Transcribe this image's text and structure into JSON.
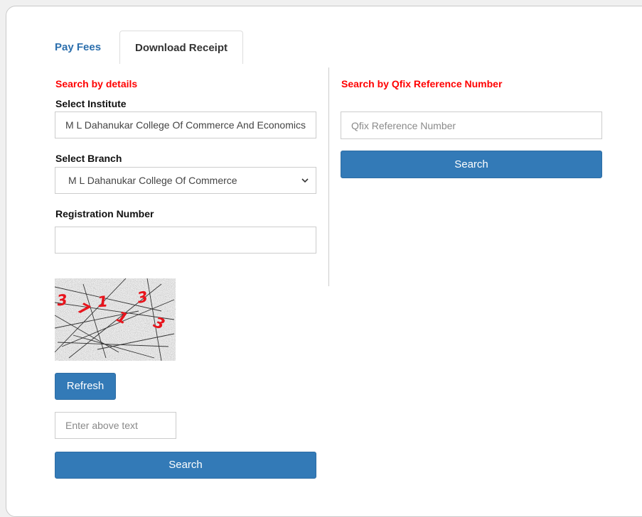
{
  "tabs": {
    "pay_fees": "Pay Fees",
    "download_receipt": "Download Receipt"
  },
  "details": {
    "title": "Search by details",
    "institute_label": "Select Institute",
    "institute_value": "M L Dahanukar College Of Commerce And Economics",
    "branch_label": "Select Branch",
    "branch_value": "M L Dahanukar College Of Commerce",
    "registration_label": "Registration Number",
    "registration_value": "",
    "refresh_label": "Refresh",
    "captcha_placeholder": "Enter above text",
    "search_label": "Search"
  },
  "captcha": {
    "characters": [
      "3",
      "7",
      "1",
      "1",
      "3",
      "3"
    ]
  },
  "qfix": {
    "title": "Search by Qfix Reference Number",
    "placeholder": "Qfix Reference Number",
    "value": "",
    "search_label": "Search"
  },
  "colors": {
    "accent_red": "#ff0000",
    "button_blue": "#337ab7",
    "tab_link_blue": "#2c6fad"
  }
}
